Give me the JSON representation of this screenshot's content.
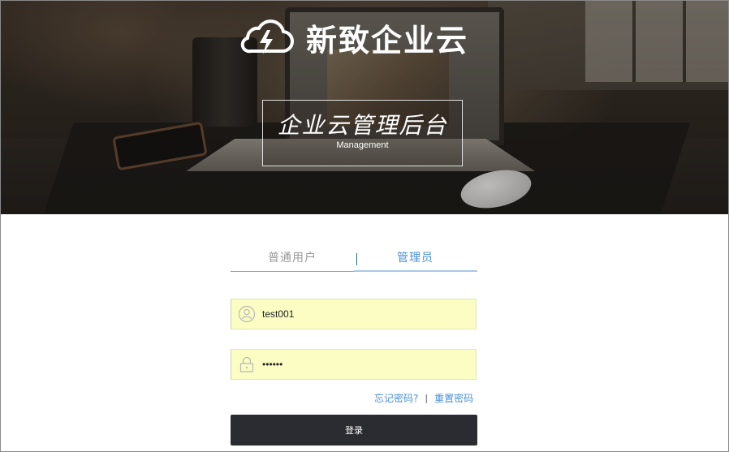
{
  "brand": {
    "name": "新致企业云",
    "logo_icon": "cloud-lightning-icon"
  },
  "hero": {
    "title": "企业云管理后台",
    "subtitle": "Management"
  },
  "login": {
    "tabs": [
      {
        "label": "普通用户",
        "active": false
      },
      {
        "label": "管理员",
        "active": true
      }
    ],
    "username": {
      "value": "test001",
      "icon": "user-icon"
    },
    "password": {
      "value": "123456",
      "icon": "lock-icon"
    },
    "forgot_password_label": "忘记密码?",
    "separator": "|",
    "reset_password_label": "重置密码",
    "submit_label": "登录"
  },
  "colors": {
    "accent": "#4a90d9",
    "input_background": "#fbfdc2",
    "button_background": "#2b2b32"
  }
}
